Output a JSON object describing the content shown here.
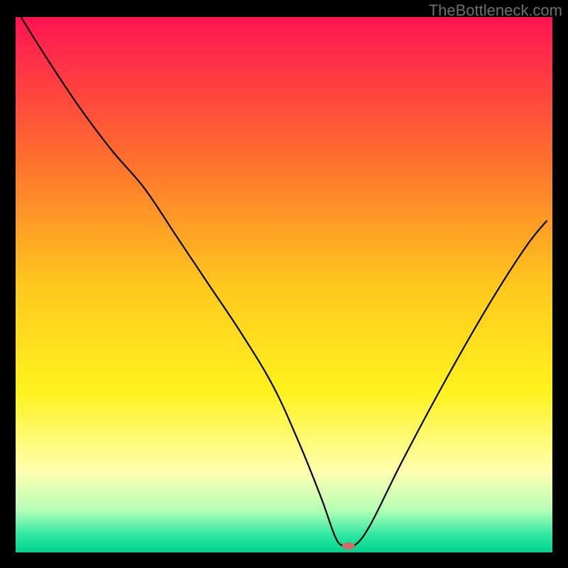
{
  "watermark": "TheBottleneck.com",
  "chart_data": {
    "type": "line",
    "title": "",
    "xlabel": "",
    "ylabel": "",
    "xlim": [
      0,
      100
    ],
    "ylim": [
      0,
      100
    ],
    "background": {
      "stops": [
        {
          "offset": 0,
          "color": "#ff1452"
        },
        {
          "offset": 25,
          "color": "#ff6a30"
        },
        {
          "offset": 50,
          "color": "#ffc81e"
        },
        {
          "offset": 70,
          "color": "#fff21e"
        },
        {
          "offset": 85,
          "color": "#ffffb0"
        },
        {
          "offset": 92,
          "color": "#b6ffb6"
        },
        {
          "offset": 97,
          "color": "#28e6a0"
        },
        {
          "offset": 100,
          "color": "#00d28c"
        }
      ]
    },
    "series": [
      {
        "name": "bottleneck-curve",
        "color": "#000000",
        "width": 2.2,
        "x": [
          1,
          6,
          12,
          18,
          24,
          30,
          36,
          42,
          48,
          53,
          57,
          59.5,
          61,
          63,
          66,
          72,
          80,
          88,
          95,
          99
        ],
        "y": [
          100,
          92,
          83,
          75,
          68,
          59,
          50,
          41,
          31,
          20,
          10,
          3,
          1.2,
          1.2,
          5,
          17,
          32,
          46,
          57,
          62
        ]
      }
    ],
    "marker": {
      "x": 62,
      "y": 1.2,
      "color": "#d46a6a",
      "rx": 9,
      "ry": 5
    }
  }
}
